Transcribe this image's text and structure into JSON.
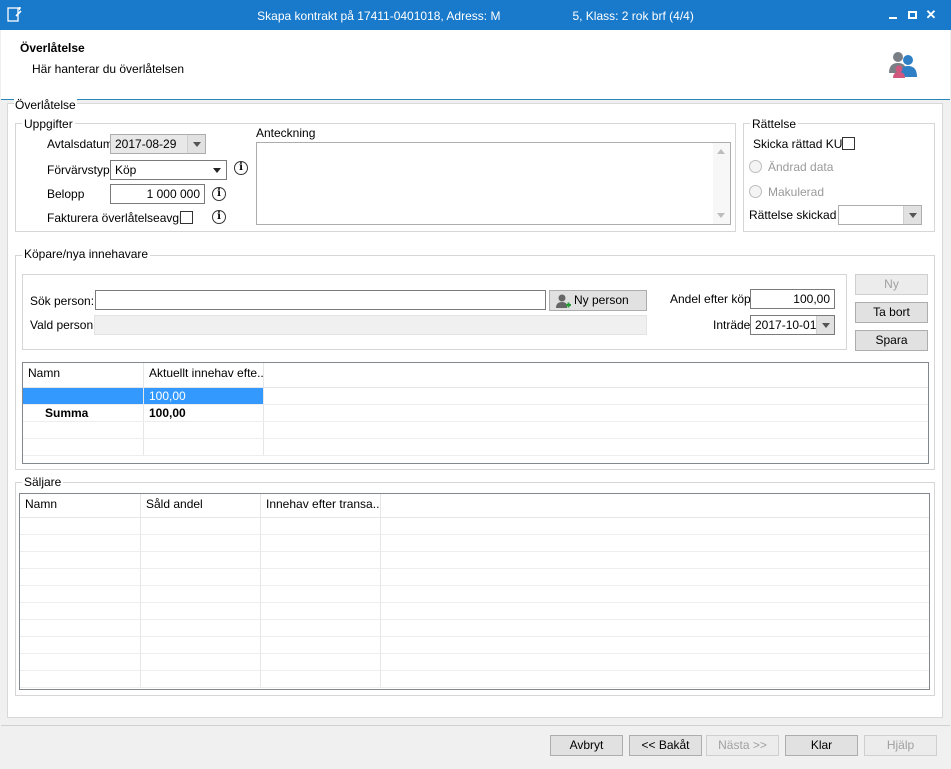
{
  "window": {
    "title": "Skapa kontrakt på 17411-0401018, Adress: M      5, Klass: 2 rok brf (4/4)",
    "minimize": "▁",
    "maximize": "▫",
    "close": "✕"
  },
  "header": {
    "title": "Överlåtelse",
    "subtitle": "Här hanterar du överlåtelsen"
  },
  "overlatelse": {
    "legend": "Överlåtelse",
    "uppgifter": {
      "legend": "Uppgifter",
      "avtalsdatum_label": "Avtalsdatum",
      "avtalsdatum_value": "2017-08-29",
      "forvarvstyp_label": "Förvärvstyp",
      "forvarvstyp_value": "Köp",
      "belopp_label": "Belopp",
      "belopp_value": "1 000 000",
      "fakturera_label": "Fakturera överlåtelseavgift",
      "anteckning_label": "Anteckning",
      "info_glyph": "i"
    },
    "rattelse": {
      "legend": "Rättelse",
      "skicka_label": "Skicka rättad KU",
      "andrad_label": "Ändrad data",
      "makulerad_label": "Makulerad",
      "skickad_label": "Rättelse skickad",
      "skickad_value": ""
    }
  },
  "kopare": {
    "legend": "Köpare/nya innehavare",
    "sok_label": "Sök person:",
    "sok_value": "",
    "ny_person_label": "Ny person",
    "vald_label": "Vald person",
    "vald_value": "",
    "andel_label": "Andel efter köp",
    "andel_value": "100,00",
    "intrade_label": "Inträde",
    "intrade_value": "2017-10-01",
    "ny_button": "Ny",
    "ta_bort_button": "Ta bort",
    "spara_button": "Spara",
    "grid": {
      "columns": [
        "Namn",
        "Aktuellt innehav efte..."
      ],
      "rows": [
        {
          "namn": "",
          "innehav": "100,00",
          "selected": true
        },
        {
          "namn": "Summa",
          "innehav": "100,00",
          "bold": true
        }
      ]
    }
  },
  "saljare": {
    "legend": "Säljare",
    "grid": {
      "columns": [
        "Namn",
        "Såld andel",
        "Innehav efter transa..."
      ]
    }
  },
  "footer": {
    "avbryt": "Avbryt",
    "bakat": "<< Bakåt",
    "nasta": "Nästa >>",
    "klar": "Klar",
    "hjalp": "Hjälp"
  },
  "colors": {
    "titlebar": "#1979ca",
    "selection": "#3399ff"
  }
}
